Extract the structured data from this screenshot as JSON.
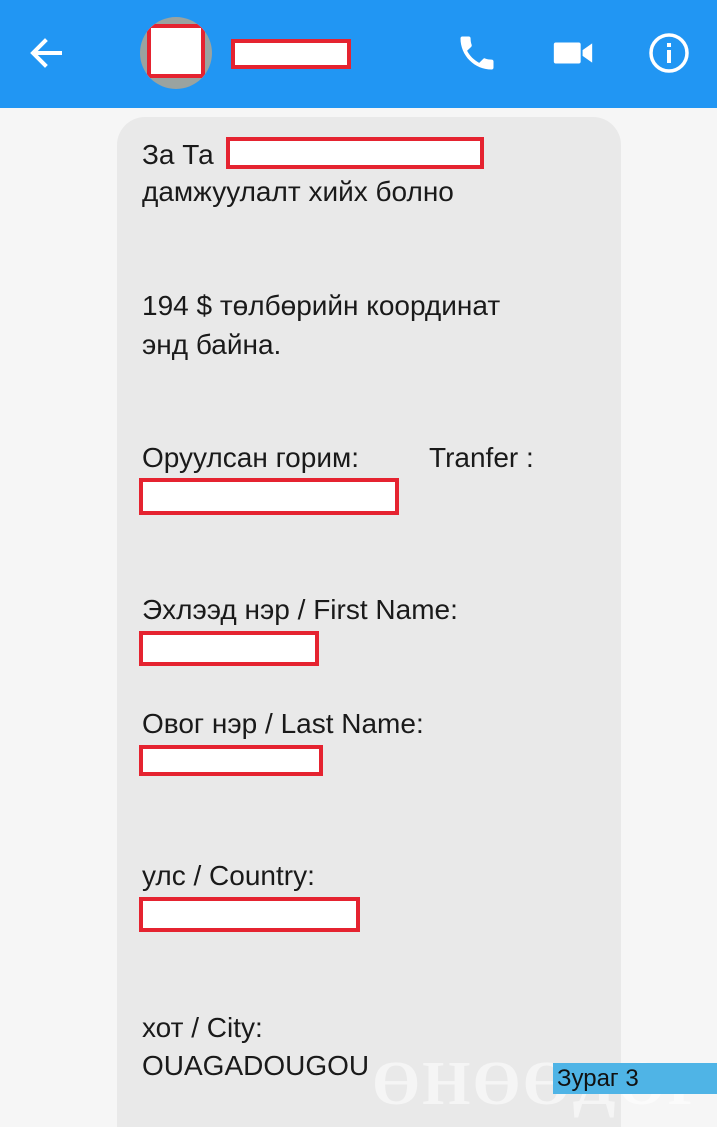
{
  "header": {
    "back_icon": "arrow-left-icon",
    "phone_icon": "phone-icon",
    "video_icon": "video-camera-icon",
    "info_icon": "info-icon",
    "background_color": "#2196f3"
  },
  "message": {
    "line1_prefix": "За Та",
    "line2": "дамжуулалт хийх болно",
    "line3": "194 $  төлбөрийн координат",
    "line4": "энд байна.",
    "mode_label": "Оруулсан горим:",
    "mode_value": "Tranfer :",
    "first_name_label": "Эхлээд нэр / First Name:",
    "last_name_label": "Овог нэр / Last Name:",
    "country_label": "улс / Country:",
    "city_label": "хот / City:",
    "city_value": "OUAGADOUGOU"
  },
  "overlay": {
    "watermark": "ӨНӨӨДӨР",
    "caption": "Зураг 3",
    "redaction_color": "#e52330"
  }
}
